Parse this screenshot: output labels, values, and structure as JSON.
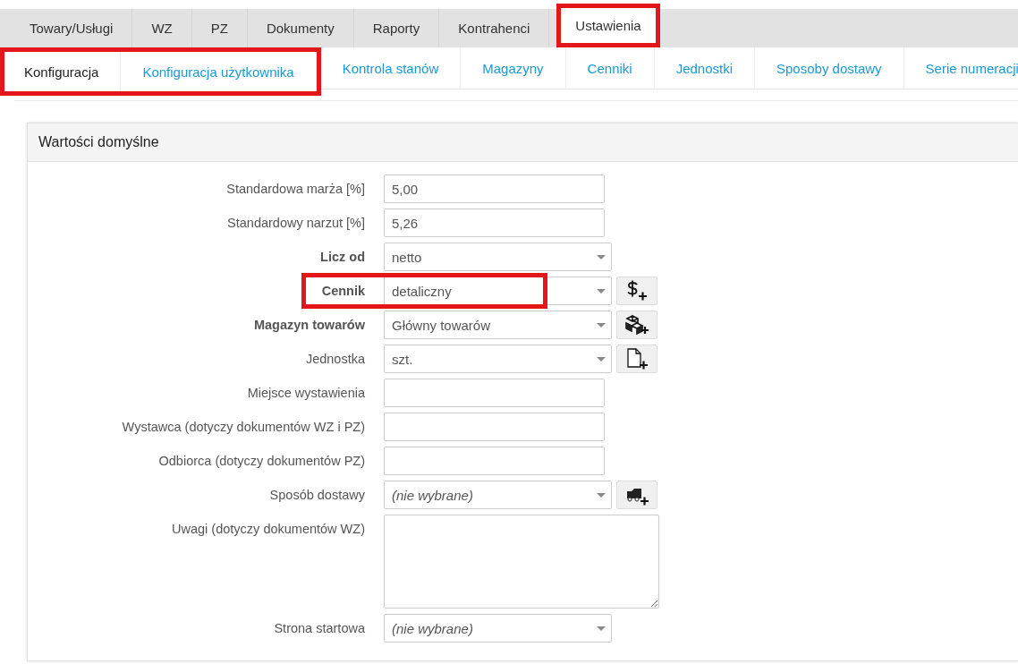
{
  "tabs": [
    {
      "label": "Towary/Usługi",
      "selected": false,
      "highlighted": false
    },
    {
      "label": "WZ",
      "selected": false,
      "highlighted": false
    },
    {
      "label": "PZ",
      "selected": false,
      "highlighted": false
    },
    {
      "label": "Dokumenty",
      "selected": false,
      "highlighted": false
    },
    {
      "label": "Raporty",
      "selected": false,
      "highlighted": false
    },
    {
      "label": "Kontrahenci",
      "selected": false,
      "highlighted": false
    },
    {
      "label": "Ustawienia",
      "selected": true,
      "highlighted": true
    }
  ],
  "subtabs": [
    {
      "label": "Konfiguracja",
      "selected": true,
      "highlighted": true
    },
    {
      "label": "Konfiguracja użytkownika",
      "selected": false,
      "highlighted": true
    },
    {
      "label": "Kontrola stanów",
      "selected": false,
      "highlighted": false
    },
    {
      "label": "Magazyny",
      "selected": false,
      "highlighted": false
    },
    {
      "label": "Cenniki",
      "selected": false,
      "highlighted": false
    },
    {
      "label": "Jednostki",
      "selected": false,
      "highlighted": false
    },
    {
      "label": "Sposoby dostawy",
      "selected": false,
      "highlighted": false
    },
    {
      "label": "Serie numeracji",
      "selected": false,
      "highlighted": false
    }
  ],
  "panel": {
    "title": "Wartości domyślne",
    "fields": [
      {
        "label": "Standardowa marża [%]",
        "kind": "text",
        "value": "5,00",
        "bold": false,
        "highlighted": false
      },
      {
        "label": "Standardowy narzut [%]",
        "kind": "text",
        "value": "5,26",
        "bold": false,
        "highlighted": false
      },
      {
        "label": "Licz od",
        "kind": "select",
        "value": "netto",
        "bold": true,
        "highlighted": false
      },
      {
        "label": "Cennik",
        "kind": "select",
        "value": "detaliczny",
        "bold": true,
        "highlighted": true,
        "add_button": {
          "kind": "dollar"
        }
      },
      {
        "label": "Magazyn towarów",
        "kind": "select",
        "value": "Główny towarów",
        "bold": true,
        "highlighted": false,
        "add_button": {
          "kind": "boxes"
        }
      },
      {
        "label": "Jednostka",
        "kind": "select",
        "value": "szt.",
        "bold": false,
        "highlighted": false,
        "add_button": {
          "kind": "document"
        }
      },
      {
        "label": "Miejsce wystawienia",
        "kind": "text",
        "bold": false,
        "highlighted": false
      },
      {
        "label": "Wystawca (dotyczy dokumentów WZ i PZ)",
        "kind": "text",
        "bold": false,
        "highlighted": false
      },
      {
        "label": "Odbiorca (dotyczy dokumentów PZ)",
        "kind": "text",
        "bold": false,
        "highlighted": false
      },
      {
        "label": "Sposób dostawy",
        "kind": "select",
        "placeholder": "(nie wybrane)",
        "bold": false,
        "highlighted": false,
        "add_button": {
          "kind": "truck"
        }
      },
      {
        "label": "Uwagi (dotyczy dokumentów WZ)",
        "kind": "textarea",
        "bold": false,
        "highlighted": false
      },
      {
        "label": "Strona startowa",
        "kind": "select",
        "placeholder": "(nie wybrane)",
        "bold": false,
        "highlighted": false
      }
    ]
  }
}
